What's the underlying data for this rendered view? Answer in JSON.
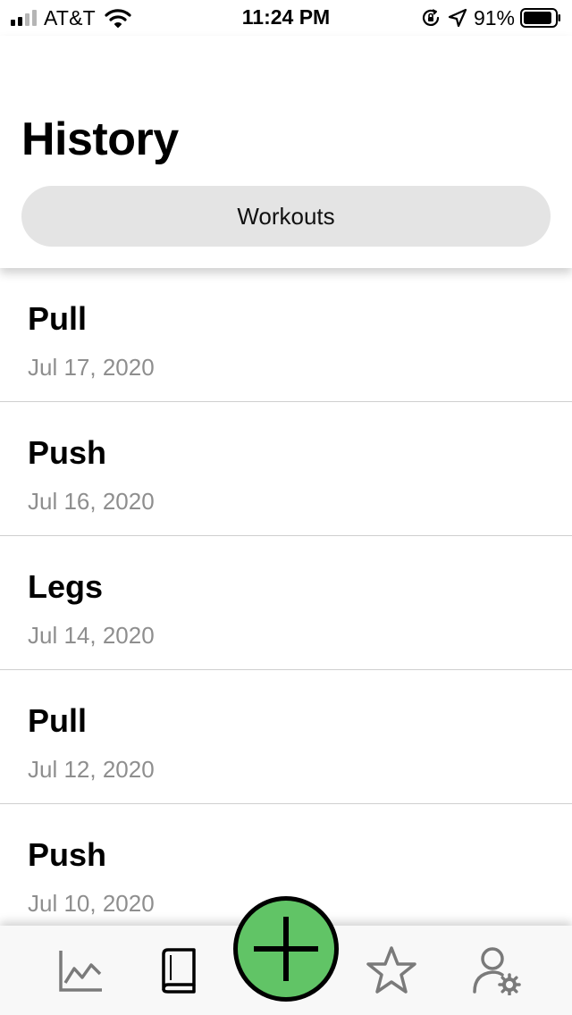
{
  "status_bar": {
    "carrier": "AT&T",
    "time": "11:24 PM",
    "battery_percent": "91%",
    "battery_level": 0.91,
    "icons": [
      "signal-icon",
      "wifi-icon",
      "orientation-lock-icon",
      "location-icon",
      "battery-icon"
    ]
  },
  "header": {
    "title": "History",
    "segment_label": "Workouts"
  },
  "workouts": [
    {
      "name": "Pull",
      "date": "Jul 17, 2020"
    },
    {
      "name": "Push",
      "date": "Jul 16, 2020"
    },
    {
      "name": "Legs",
      "date": "Jul 14, 2020"
    },
    {
      "name": "Pull",
      "date": "Jul 12, 2020"
    },
    {
      "name": "Push",
      "date": "Jul 10, 2020"
    }
  ],
  "tab_bar": {
    "tabs": [
      "chart-icon",
      "book-icon",
      "add-icon",
      "star-icon",
      "profile-settings-icon"
    ],
    "accent_color": "#61c466",
    "icon_color": "#7a7a7a"
  }
}
